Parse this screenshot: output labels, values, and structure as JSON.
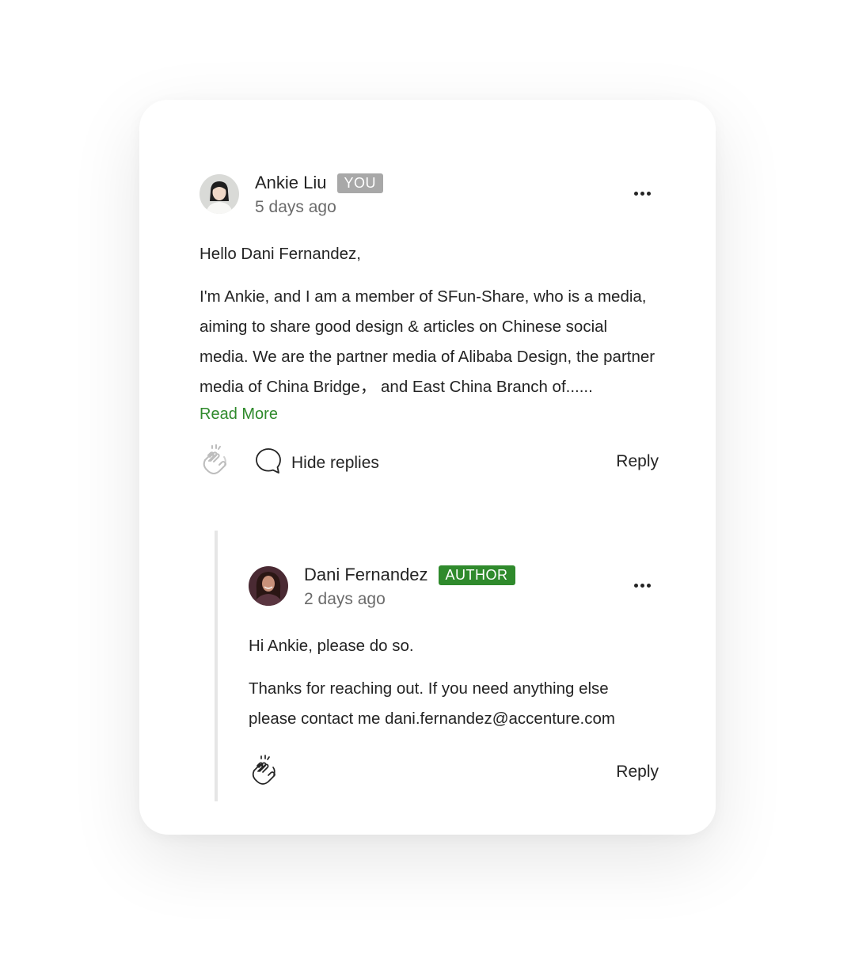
{
  "comment": {
    "author": "Ankie Liu",
    "badge": "YOU",
    "time": "5 days ago",
    "greeting": "Hello Dani Fernandez,",
    "body": "I'm Ankie, and I am a member of SFun-Share, who is a media, aiming to share good design & articles on Chinese social media. We are the partner media of Alibaba Design, the partner media of China Bridge， and East China Branch of......",
    "read_more": "Read More",
    "hide_replies": "Hide replies",
    "reply": "Reply"
  },
  "reply": {
    "author": "Dani Fernandez",
    "badge": "AUTHOR",
    "time": "2 days ago",
    "greeting": "Hi Ankie, please do so.",
    "body": "Thanks for reaching out. If you need anything else please contact me dani.fernandez@accenture.com",
    "reply": "Reply"
  },
  "colors": {
    "accent_green": "#2f8a2c",
    "you_badge": "#a8a8a8",
    "text": "#242424",
    "muted": "#6b6b6b"
  },
  "icons": [
    "more-horizontal-icon",
    "clap-icon",
    "speech-bubble-icon"
  ]
}
